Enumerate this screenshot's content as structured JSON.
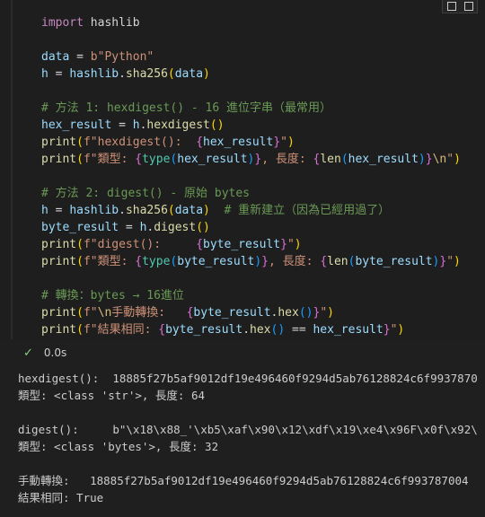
{
  "code_lines": [
    [
      {
        "t": "import",
        "c": "kw"
      },
      {
        "t": " hashlib",
        "c": "op"
      }
    ],
    [],
    [
      {
        "t": "data",
        "c": "var"
      },
      {
        "t": " = ",
        "c": "op"
      },
      {
        "t": "b\"Python\"",
        "c": "str"
      }
    ],
    [
      {
        "t": "h",
        "c": "var"
      },
      {
        "t": " = ",
        "c": "op"
      },
      {
        "t": "hashlib",
        "c": "var"
      },
      {
        "t": ".",
        "c": "op"
      },
      {
        "t": "sha256",
        "c": "fn"
      },
      {
        "t": "(",
        "c": "br"
      },
      {
        "t": "data",
        "c": "var"
      },
      {
        "t": ")",
        "c": "br"
      }
    ],
    [],
    [
      {
        "t": "# 方法 1: hexdigest() - 16 進位字串（最常用）",
        "c": "cm"
      }
    ],
    [
      {
        "t": "hex_result",
        "c": "var"
      },
      {
        "t": " = ",
        "c": "op"
      },
      {
        "t": "h",
        "c": "var"
      },
      {
        "t": ".",
        "c": "op"
      },
      {
        "t": "hexdigest",
        "c": "fn"
      },
      {
        "t": "()",
        "c": "br"
      }
    ],
    [
      {
        "t": "print",
        "c": "fn"
      },
      {
        "t": "(",
        "c": "br"
      },
      {
        "t": "f\"hexdigest():  ",
        "c": "str"
      },
      {
        "t": "{",
        "c": "br2"
      },
      {
        "t": "hex_result",
        "c": "var"
      },
      {
        "t": "}",
        "c": "br2"
      },
      {
        "t": "\"",
        "c": "str"
      },
      {
        "t": ")",
        "c": "br"
      }
    ],
    [
      {
        "t": "print",
        "c": "fn"
      },
      {
        "t": "(",
        "c": "br"
      },
      {
        "t": "f\"類型: ",
        "c": "str"
      },
      {
        "t": "{",
        "c": "br2"
      },
      {
        "t": "type",
        "c": "cls"
      },
      {
        "t": "(",
        "c": "br3"
      },
      {
        "t": "hex_result",
        "c": "var"
      },
      {
        "t": ")",
        "c": "br3"
      },
      {
        "t": "}",
        "c": "br2"
      },
      {
        "t": ", 長度: ",
        "c": "str"
      },
      {
        "t": "{",
        "c": "br2"
      },
      {
        "t": "len",
        "c": "fn"
      },
      {
        "t": "(",
        "c": "br3"
      },
      {
        "t": "hex_result",
        "c": "var"
      },
      {
        "t": ")",
        "c": "br3"
      },
      {
        "t": "}",
        "c": "br2"
      },
      {
        "t": "\\n",
        "c": "esc"
      },
      {
        "t": "\"",
        "c": "str"
      },
      {
        "t": ")",
        "c": "br"
      }
    ],
    [],
    [
      {
        "t": "# 方法 2: digest() - 原始 bytes",
        "c": "cm"
      }
    ],
    [
      {
        "t": "h",
        "c": "var"
      },
      {
        "t": " = ",
        "c": "op"
      },
      {
        "t": "hashlib",
        "c": "var"
      },
      {
        "t": ".",
        "c": "op"
      },
      {
        "t": "sha256",
        "c": "fn"
      },
      {
        "t": "(",
        "c": "br"
      },
      {
        "t": "data",
        "c": "var"
      },
      {
        "t": ")",
        "c": "br"
      },
      {
        "t": "  # 重新建立（因為已經用過了）",
        "c": "cm"
      }
    ],
    [
      {
        "t": "byte_result",
        "c": "var"
      },
      {
        "t": " = ",
        "c": "op"
      },
      {
        "t": "h",
        "c": "var"
      },
      {
        "t": ".",
        "c": "op"
      },
      {
        "t": "digest",
        "c": "fn"
      },
      {
        "t": "()",
        "c": "br"
      }
    ],
    [
      {
        "t": "print",
        "c": "fn"
      },
      {
        "t": "(",
        "c": "br"
      },
      {
        "t": "f\"digest():     ",
        "c": "str"
      },
      {
        "t": "{",
        "c": "br2"
      },
      {
        "t": "byte_result",
        "c": "var"
      },
      {
        "t": "}",
        "c": "br2"
      },
      {
        "t": "\"",
        "c": "str"
      },
      {
        "t": ")",
        "c": "br"
      }
    ],
    [
      {
        "t": "print",
        "c": "fn"
      },
      {
        "t": "(",
        "c": "br"
      },
      {
        "t": "f\"類型: ",
        "c": "str"
      },
      {
        "t": "{",
        "c": "br2"
      },
      {
        "t": "type",
        "c": "cls"
      },
      {
        "t": "(",
        "c": "br3"
      },
      {
        "t": "byte_result",
        "c": "var"
      },
      {
        "t": ")",
        "c": "br3"
      },
      {
        "t": "}",
        "c": "br2"
      },
      {
        "t": ", 長度: ",
        "c": "str"
      },
      {
        "t": "{",
        "c": "br2"
      },
      {
        "t": "len",
        "c": "fn"
      },
      {
        "t": "(",
        "c": "br3"
      },
      {
        "t": "byte_result",
        "c": "var"
      },
      {
        "t": ")",
        "c": "br3"
      },
      {
        "t": "}",
        "c": "br2"
      },
      {
        "t": "\"",
        "c": "str"
      },
      {
        "t": ")",
        "c": "br"
      }
    ],
    [],
    [
      {
        "t": "# 轉換：bytes → 16進位",
        "c": "cm"
      }
    ],
    [
      {
        "t": "print",
        "c": "fn"
      },
      {
        "t": "(",
        "c": "br"
      },
      {
        "t": "f\"",
        "c": "str"
      },
      {
        "t": "\\n",
        "c": "esc"
      },
      {
        "t": "手動轉換:   ",
        "c": "str"
      },
      {
        "t": "{",
        "c": "br2"
      },
      {
        "t": "byte_result",
        "c": "var"
      },
      {
        "t": ".",
        "c": "op"
      },
      {
        "t": "hex",
        "c": "fn"
      },
      {
        "t": "()",
        "c": "br3"
      },
      {
        "t": "}",
        "c": "br2"
      },
      {
        "t": "\"",
        "c": "str"
      },
      {
        "t": ")",
        "c": "br"
      }
    ],
    [
      {
        "t": "print",
        "c": "fn"
      },
      {
        "t": "(",
        "c": "br"
      },
      {
        "t": "f\"結果相同: ",
        "c": "str"
      },
      {
        "t": "{",
        "c": "br2"
      },
      {
        "t": "byte_result",
        "c": "var"
      },
      {
        "t": ".",
        "c": "op"
      },
      {
        "t": "hex",
        "c": "fn"
      },
      {
        "t": "()",
        "c": "br3"
      },
      {
        "t": " == ",
        "c": "op"
      },
      {
        "t": "hex_result",
        "c": "var"
      },
      {
        "t": "}",
        "c": "br2"
      },
      {
        "t": "\"",
        "c": "str"
      },
      {
        "t": ")",
        "c": "br"
      }
    ]
  ],
  "status": {
    "check_icon": "check-icon",
    "time": "0.0s"
  },
  "output_lines": [
    "hexdigest():  18885f27b5af9012df19e496460f9294d5ab76128824c6f9937870",
    "類型: <class 'str'>, 長度: 64",
    "",
    "digest():     b\"\\x18\\x88_'\\xb5\\xaf\\x90\\x12\\xdf\\x19\\xe4\\x96F\\x0f\\x92\\",
    "類型: <class 'bytes'>, 長度: 32",
    "",
    "手動轉換:   18885f27b5af9012df19e496460f9294d5ab76128824c6f993787004",
    "結果相同: True"
  ],
  "colors": {
    "editor_bg": "#1e1e1e",
    "output_bg": "#1f1f1f",
    "check": "#89d185"
  }
}
